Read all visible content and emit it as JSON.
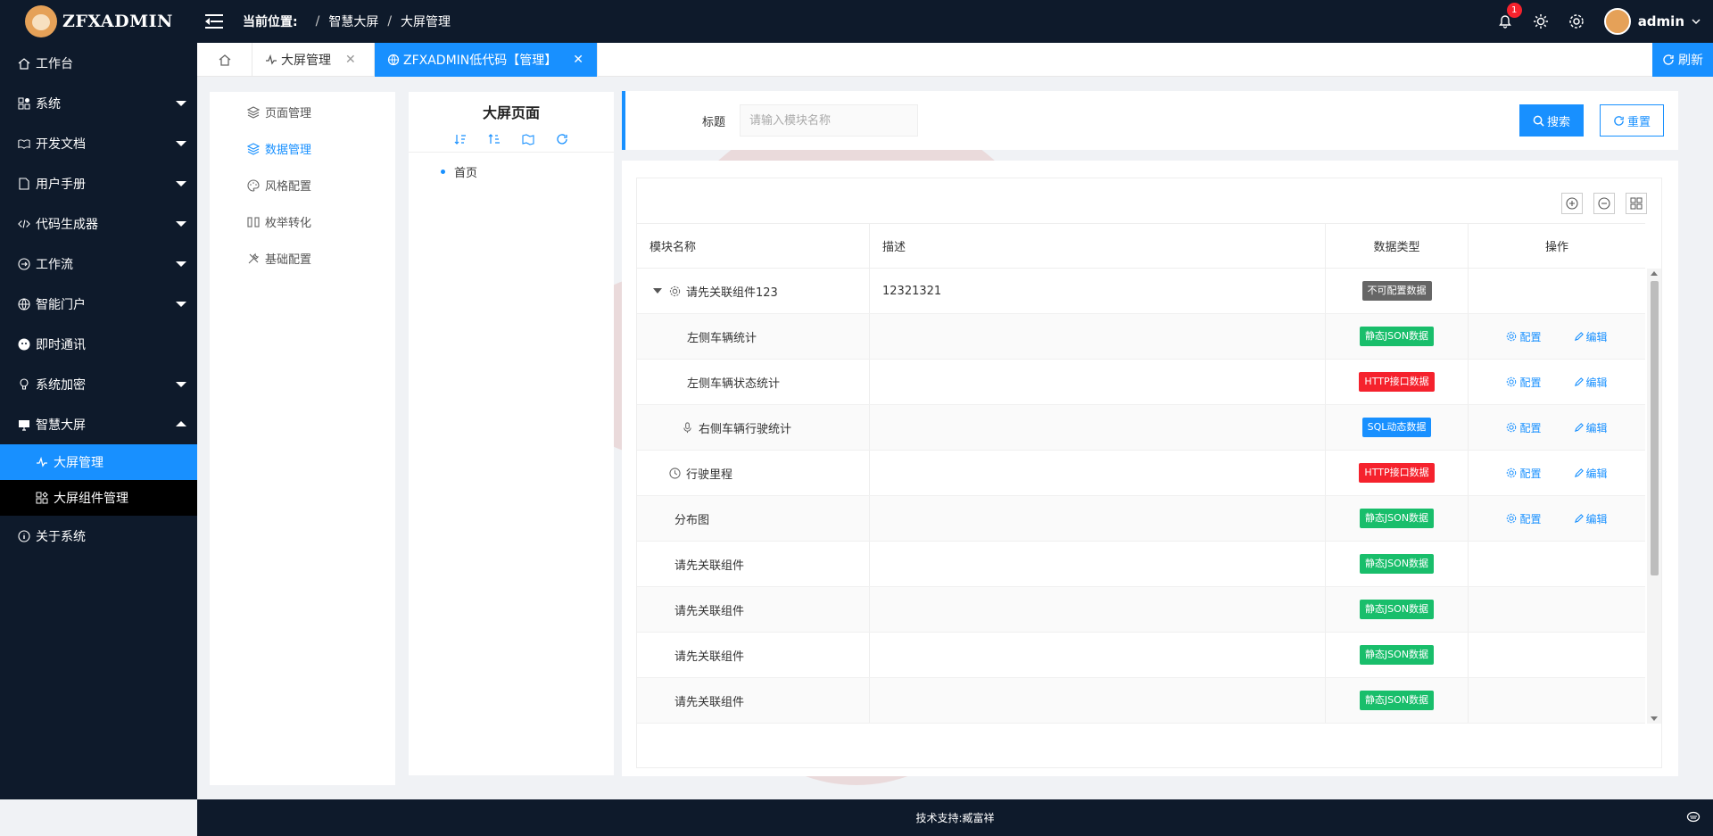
{
  "header": {
    "logo_text": "ZFXADMIN",
    "breadcrumb_label": "当前位置:",
    "breadcrumb": [
      "智慧大屏",
      "大屏管理"
    ],
    "notification_count": "1",
    "username": "admin"
  },
  "sidebar": {
    "items": [
      {
        "label": "工作台",
        "icon": "home-icon",
        "caret": false
      },
      {
        "label": "系统",
        "icon": "apps-icon",
        "caret": true
      },
      {
        "label": "开发文档",
        "icon": "book-icon",
        "caret": true
      },
      {
        "label": "用户手册",
        "icon": "document-icon",
        "caret": true
      },
      {
        "label": "代码生成器",
        "icon": "code-icon",
        "caret": true
      },
      {
        "label": "工作流",
        "icon": "workflow-icon",
        "caret": true
      },
      {
        "label": "智能门户",
        "icon": "globe-icon",
        "caret": true
      },
      {
        "label": "即时通讯",
        "icon": "chat-icon",
        "caret": false
      },
      {
        "label": "系统加密",
        "icon": "bulb-icon",
        "caret": true
      },
      {
        "label": "智慧大屏",
        "icon": "screen-icon",
        "caret": "up"
      }
    ],
    "subitems": [
      {
        "label": "大屏管理",
        "icon": "pulse-icon",
        "active": true
      },
      {
        "label": "大屏组件管理",
        "icon": "widget-icon",
        "active": false
      }
    ],
    "about": {
      "label": "关于系统",
      "icon": "info-icon"
    }
  },
  "tabs": {
    "home_icon": "home-icon",
    "items": [
      {
        "label": "大屏管理",
        "icon": "pulse-icon"
      },
      {
        "label": "ZFXADMIN低代码【管理】",
        "icon": "globe-icon"
      }
    ],
    "refresh_label": "刷新"
  },
  "config_menu": [
    {
      "label": "页面管理",
      "icon": "layers-icon",
      "active": false
    },
    {
      "label": "数据管理",
      "icon": "layers-icon",
      "active": true
    },
    {
      "label": "风格配置",
      "icon": "palette-icon",
      "active": false
    },
    {
      "label": "枚举转化",
      "icon": "convert-icon",
      "active": false
    },
    {
      "label": "基础配置",
      "icon": "tools-icon",
      "active": false
    }
  ],
  "tree": {
    "title": "大屏页面",
    "tools": [
      "sort-down-icon",
      "sort-up-icon",
      "map-icon",
      "refresh-icon"
    ],
    "nodes": [
      "首页"
    ]
  },
  "search": {
    "label": "标题",
    "placeholder": "请输入模块名称",
    "value": "",
    "search_label": "搜索",
    "reset_label": "重置"
  },
  "table": {
    "tools": [
      "add-circle-icon",
      "minus-circle-icon",
      "columns-icon"
    ],
    "columns": [
      "模块名称",
      "描述",
      "数据类型",
      "操作"
    ],
    "op_config": "配置",
    "op_edit": "编辑",
    "rows": [
      {
        "name": "请先关联组件123",
        "desc": "12321321",
        "type": "不可配置数据",
        "color": "gray",
        "indent": 0,
        "expand": true,
        "icon": "gear-icon",
        "ops": false
      },
      {
        "name": "左侧车辆统计",
        "desc": "",
        "type": "静态JSON数据",
        "color": "green",
        "indent": 2,
        "expand": false,
        "icon": "",
        "ops": true
      },
      {
        "name": "左侧车辆状态统计",
        "desc": "",
        "type": "HTTP接口数据",
        "color": "red",
        "indent": 2,
        "expand": false,
        "icon": "",
        "ops": true
      },
      {
        "name": "右侧车辆行驶统计",
        "desc": "",
        "type": "SQL动态数据",
        "color": "blue",
        "indent": 2,
        "expand": false,
        "icon": "mic-icon",
        "ops": true
      },
      {
        "name": "行驶里程",
        "desc": "",
        "type": "HTTP接口数据",
        "color": "red",
        "indent": 1,
        "expand": false,
        "icon": "clock-icon",
        "ops": true
      },
      {
        "name": "分布图",
        "desc": "",
        "type": "静态JSON数据",
        "color": "green",
        "indent": 1,
        "expand": false,
        "icon": "",
        "ops": true
      },
      {
        "name": "请先关联组件",
        "desc": "",
        "type": "静态JSON数据",
        "color": "green",
        "indent": 1,
        "expand": false,
        "icon": "",
        "ops": false
      },
      {
        "name": "请先关联组件",
        "desc": "",
        "type": "静态JSON数据",
        "color": "green",
        "indent": 1,
        "expand": false,
        "icon": "",
        "ops": false
      },
      {
        "name": "请先关联组件",
        "desc": "",
        "type": "静态JSON数据",
        "color": "green",
        "indent": 1,
        "expand": false,
        "icon": "",
        "ops": false
      },
      {
        "name": "请先关联组件",
        "desc": "",
        "type": "静态JSON数据",
        "color": "green",
        "indent": 1,
        "expand": false,
        "icon": "",
        "ops": false
      }
    ]
  },
  "footer": {
    "text": "技术支持:臧富祥"
  },
  "colors": {
    "primary": "#1890ff",
    "dark": "#0e1a2b",
    "green": "#19be6b",
    "red": "#f5222d",
    "gray": "#666666"
  }
}
